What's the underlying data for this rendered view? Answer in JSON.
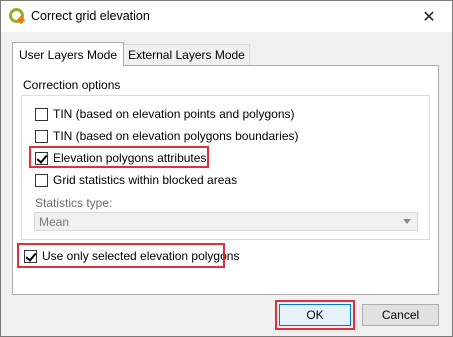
{
  "window": {
    "title": "Correct grid elevation",
    "close_label": "✕"
  },
  "tabs": [
    {
      "label": "User Layers Mode",
      "active": true
    },
    {
      "label": "External Layers Mode",
      "active": false
    }
  ],
  "correction": {
    "group_title": "Correction options",
    "options": [
      {
        "label": "TIN (based on elevation points and polygons)",
        "checked": false
      },
      {
        "label": "TIN (based on elevation polygons boundaries)",
        "checked": false
      },
      {
        "label": "Elevation polygons attributes",
        "checked": true
      },
      {
        "label": "Grid statistics within blocked areas",
        "checked": false
      }
    ],
    "statistics_label": "Statistics type:",
    "statistics_value": "Mean"
  },
  "selected_only": {
    "label": "Use only selected elevation polygons",
    "checked": true
  },
  "buttons": {
    "ok": "OK",
    "cancel": "Cancel"
  },
  "colors": {
    "highlight": "#e0303c",
    "accent": "#0078d7",
    "qgis_green": "#93b023"
  }
}
